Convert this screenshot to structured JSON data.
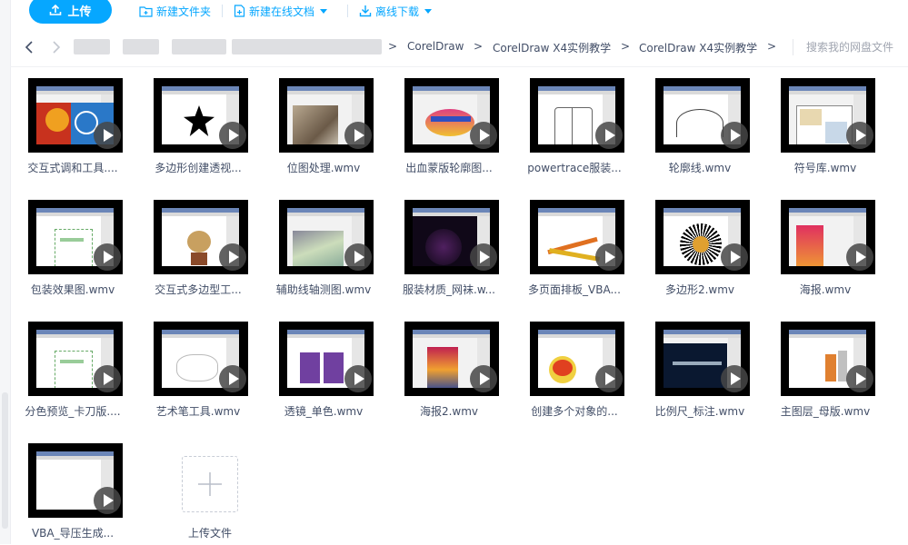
{
  "toolbar": {
    "upload_label": "上传",
    "new_folder_label": "新建文件夹",
    "new_online_doc_label": "新建在线文档",
    "offline_download_label": "离线下载"
  },
  "nav": {
    "breadcrumbs": [
      "CorelDraw",
      "CorelDraw X4实例教学",
      "CorelDraw X4实例教学"
    ],
    "separator": ">",
    "search_placeholder": "搜索我的网盘文件"
  },
  "files": [
    {
      "name": "交互式调和工具....",
      "thumb": "orange-blue"
    },
    {
      "name": "多边形创建透视...",
      "thumb": "star"
    },
    {
      "name": "位图处理.wmv",
      "thumb": "photo"
    },
    {
      "name": "出血蒙版轮廓图...",
      "thumb": "logo"
    },
    {
      "name": "powertrace服装...",
      "thumb": "shirt"
    },
    {
      "name": "轮廓线.wmv",
      "thumb": "curve"
    },
    {
      "name": "符号库.wmv",
      "thumb": "plan"
    },
    {
      "name": "包装效果图.wmv",
      "thumb": "package"
    },
    {
      "name": "交互式多边型工...",
      "thumb": "character"
    },
    {
      "name": "辅助线轴测图.wmv",
      "thumb": "iso"
    },
    {
      "name": "服装材质_网袜.w...",
      "thumb": "dark"
    },
    {
      "name": "多页面排板_VBA...",
      "thumb": "pencils"
    },
    {
      "name": "多边形2.wmv",
      "thumb": "sunburst"
    },
    {
      "name": "海报.wmv",
      "thumb": "poster"
    },
    {
      "name": "分色预览_卡刀版....",
      "thumb": "package"
    },
    {
      "name": "艺术笔工具.wmv",
      "thumb": "sketch"
    },
    {
      "name": "透镜_单色.wmv",
      "thumb": "purple"
    },
    {
      "name": "海报2.wmv",
      "thumb": "poster2"
    },
    {
      "name": "创建多个对象的...",
      "thumb": "monkey"
    },
    {
      "name": "比例尺_标注.wmv",
      "thumb": "knife"
    },
    {
      "name": "主图层_母版.wmv",
      "thumb": "cups"
    },
    {
      "name": "VBA_导压生成...",
      "thumb": "blank"
    }
  ],
  "upload_tile_label": "上传文件",
  "colors": {
    "accent": "#06a7ff",
    "text": "#424e67"
  }
}
